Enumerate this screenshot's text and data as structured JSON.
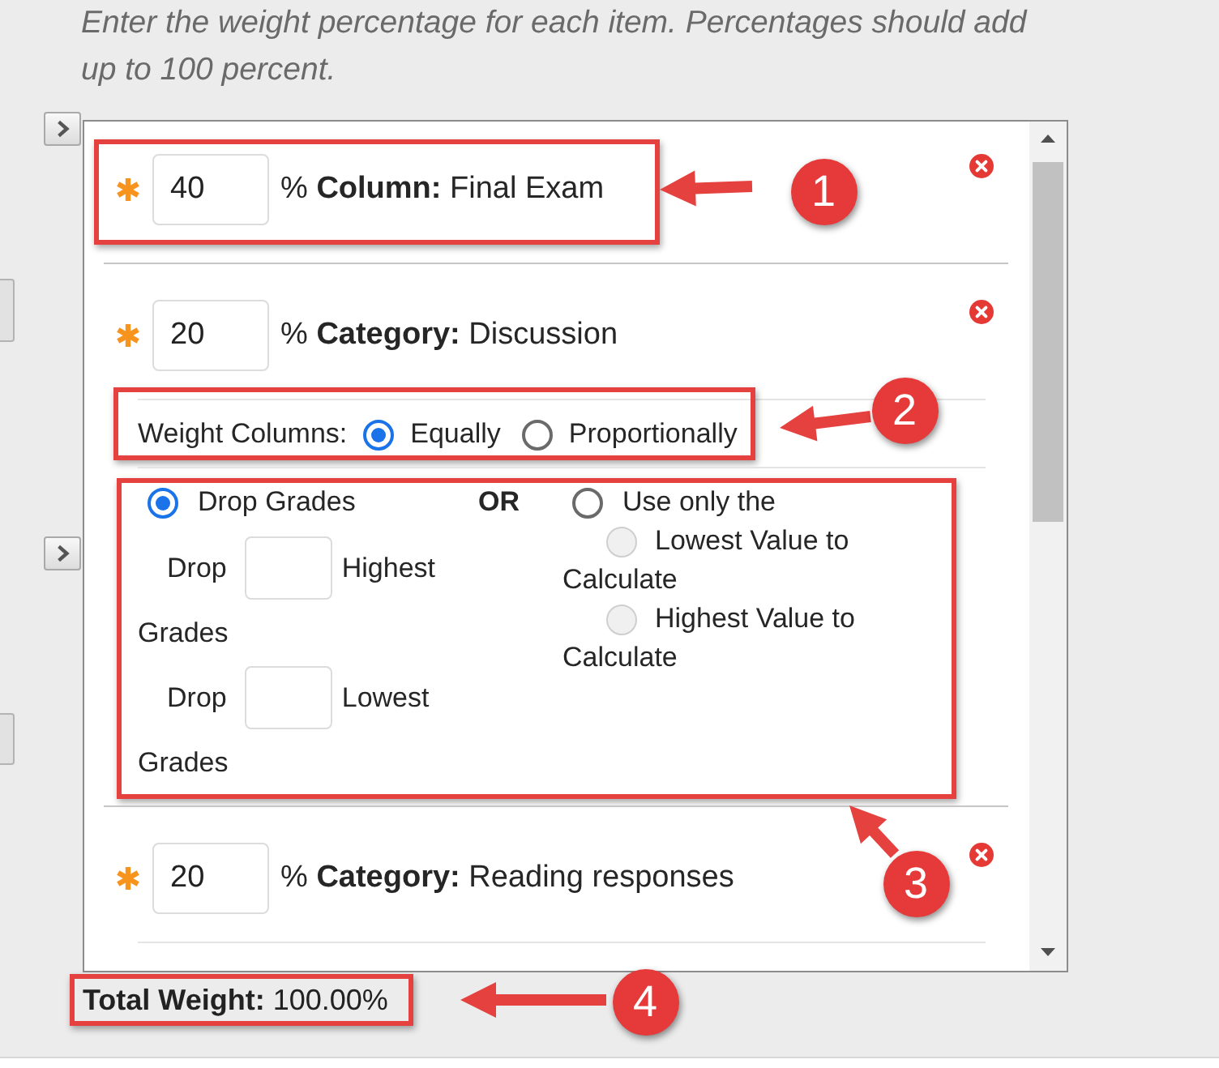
{
  "instructions": "Enter the weight percentage for each item. Percentages should add up to 100 percent.",
  "items": [
    {
      "kind": "column",
      "weight": "40",
      "label": "% **Column:** Final Exam",
      "highlighted": true
    },
    {
      "kind": "category",
      "weight": "20",
      "label": "% **Category:** Discussion",
      "highlighted": false,
      "weight_columns": {
        "label": "Weight Columns:",
        "highlighted": true,
        "options": [
          {
            "label": "Equally",
            "selected": true
          },
          {
            "label": "Proportionally",
            "selected": false
          }
        ]
      },
      "drop": {
        "highlighted": true,
        "modes": [
          {
            "label": "Drop Grades",
            "selected": true
          },
          {
            "label": "Use only the",
            "selected": false
          }
        ],
        "separator": "OR",
        "drop_fields": [
          {
            "before": "Drop",
            "after": "Highest",
            "continued": "Grades"
          },
          {
            "before": "Drop",
            "after": "Lowest",
            "continued": "Grades"
          }
        ],
        "value_options": [
          {
            "label": "Lowest Value to",
            "continued": "Calculate",
            "selected": false,
            "disabled": true
          },
          {
            "label": "Highest Value to",
            "continued": "Calculate",
            "selected": false,
            "disabled": true
          }
        ]
      }
    },
    {
      "kind": "category",
      "weight": "20",
      "label": "% **Category:** Reading responses",
      "highlighted": false
    }
  ],
  "total": {
    "text": "**Total Weight:** 100.00%",
    "highlighted": true
  },
  "callouts": [
    {
      "label": "1"
    },
    {
      "label": "2"
    },
    {
      "label": "3"
    },
    {
      "label": "4"
    }
  ]
}
